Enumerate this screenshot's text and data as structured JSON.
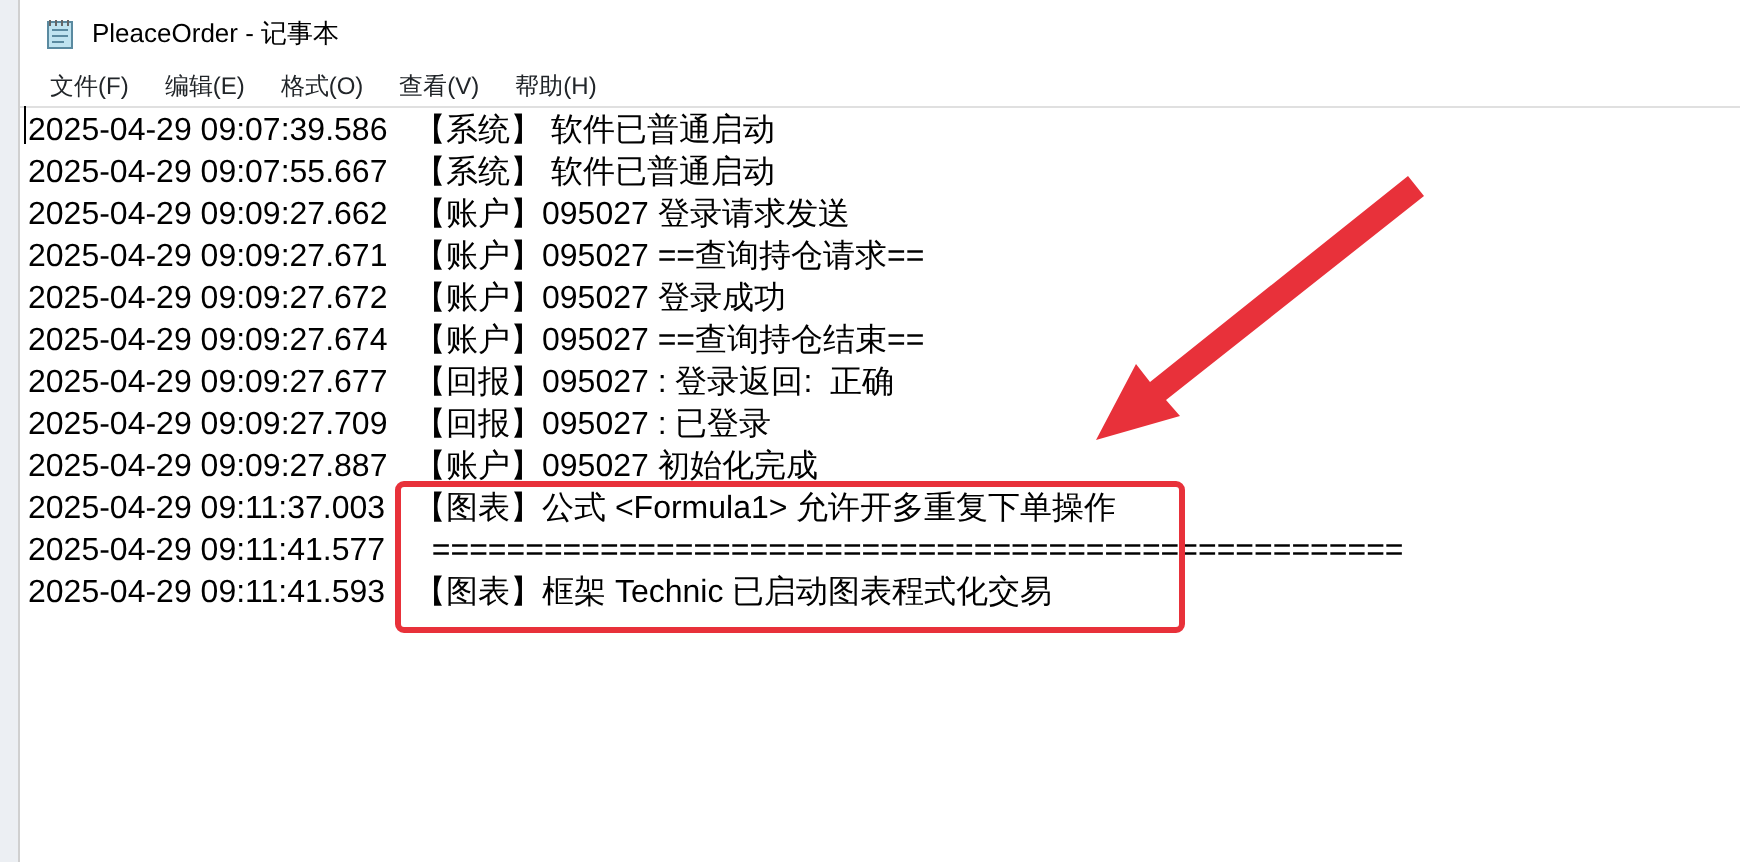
{
  "window": {
    "title": "PleaceOrder - 记事本"
  },
  "menu": [
    "文件(F)",
    "编辑(E)",
    "格式(O)",
    "查看(V)",
    "帮助(H)"
  ],
  "lines": [
    {
      "time": "2025-04-29 09:07:39.586",
      "message": "【系统】 软件已普通启动",
      "highlighted": false
    },
    {
      "time": "2025-04-29 09:07:55.667",
      "message": "【系统】 软件已普通启动",
      "highlighted": false
    },
    {
      "time": "2025-04-29 09:09:27.662",
      "message": "【账户】095027 登录请求发送",
      "highlighted": false
    },
    {
      "time": "2025-04-29 09:09:27.671",
      "message": "【账户】095027 ==查询持仓请求==",
      "highlighted": false
    },
    {
      "time": "2025-04-29 09:09:27.672",
      "message": "【账户】095027 登录成功",
      "highlighted": false
    },
    {
      "time": "2025-04-29 09:09:27.674",
      "message": "【账户】095027 ==查询持仓结束==",
      "highlighted": false
    },
    {
      "time": "2025-04-29 09:09:27.677",
      "message": "【回报】095027 : 登录返回:  正确",
      "highlighted": false
    },
    {
      "time": "2025-04-29 09:09:27.709",
      "message": "【回报】095027 : 已登录",
      "highlighted": false
    },
    {
      "time": "2025-04-29 09:09:27.887",
      "message": "【账户】095027 初始化完成",
      "highlighted": false
    },
    {
      "time": "2025-04-29 09:11:37.003",
      "message": "【图表】公式 <Formula1> 允许开多重复下单操作",
      "highlighted": true
    },
    {
      "time": "2025-04-29 09:11:41.577",
      "message": "  ====================================================",
      "highlighted": true
    },
    {
      "time": "2025-04-29 09:11:41.593",
      "message": "【图表】框架 Technic 已启动图表程式化交易",
      "highlighted": true
    }
  ]
}
